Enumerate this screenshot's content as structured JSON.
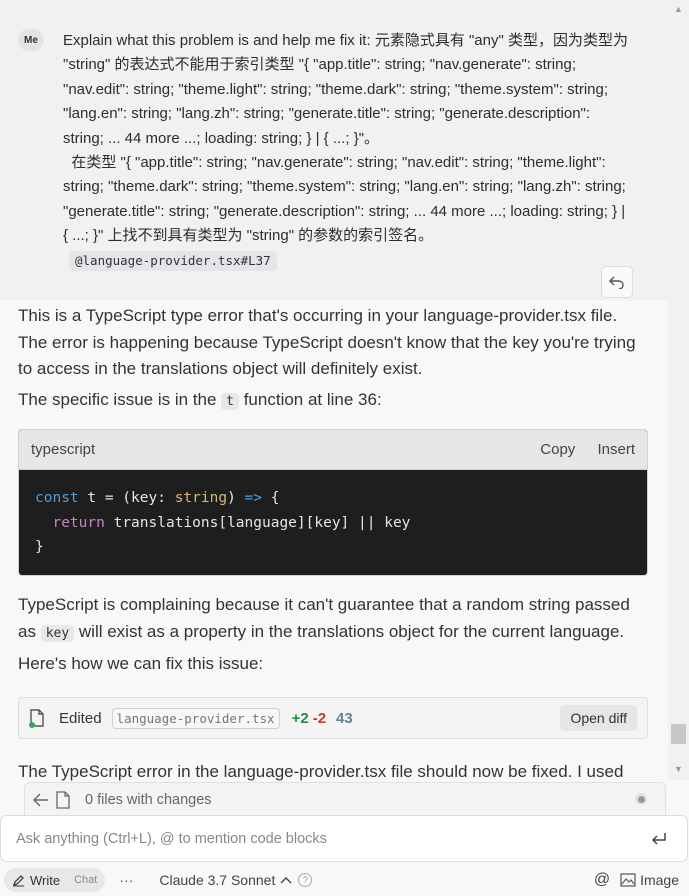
{
  "user_message": {
    "avatar": "Me",
    "text": "Explain what this problem is and help me fix it: 元素隐式具有 \"any\" 类型，因为类型为 \"string\" 的表达式不能用于索引类型 \"{ \"app.title\": string; \"nav.generate\": string; \"nav.edit\": string; \"theme.light\": string; \"theme.dark\": string; \"theme.system\": string; \"lang.en\": string; \"lang.zh\": string; \"generate.title\": string; \"generate.description\": string; ... 44 more ...; loading: string; } | { ...; }\"。\n  在类型 \"{ \"app.title\": string; \"nav.generate\": string; \"nav.edit\": string; \"theme.light\": string; \"theme.dark\": string; \"theme.system\": string; \"lang.en\": string; \"lang.zh\": string; \"generate.title\": string; \"generate.description\": string; ... 44 more ...; loading: string; } | { ...; }\" 上找不到具有类型为 \"string\" 的参数的索引签名。",
    "reference_chip": "@language-provider.tsx#L37"
  },
  "assistant": {
    "para1": "This is a TypeScript type error that's occurring in your language-provider.tsx file. The error is happening because TypeScript doesn't know that the key you're trying to access in the translations object will definitely exist.",
    "para2_before": "The specific issue is in the ",
    "para2_code": "t",
    "para2_after": " function at line 36:",
    "code_block": {
      "language": "typescript",
      "copy_label": "Copy",
      "insert_label": "Insert",
      "lines": [
        "const t = (key: string) => {",
        "  return translations[language][key] || key",
        "}"
      ]
    },
    "para3_before": "TypeScript is complaining because it can't guarantee that a random string passed as ",
    "para3_code": "key",
    "para3_after": " will exist as a property in the translations object for the current language.",
    "para4": "Here's how we can fix this issue:",
    "edit_card": {
      "label": "Edited",
      "file": "language-provider.tsx",
      "added": "+2",
      "removed": "-2",
      "lines": "43",
      "open_diff_label": "Open diff"
    },
    "para5": "The TypeScript error in the language-provider.tsx file should now be fixed. I used"
  },
  "files_bar": {
    "text": "0 files with changes"
  },
  "composer": {
    "placeholder": "Ask anything (Ctrl+L), @ to mention code blocks"
  },
  "bottom_bar": {
    "write_label": "Write",
    "chat_label": "Chat",
    "more_label": "···",
    "model_label": "Claude 3.7 Sonnet",
    "help_label": "?",
    "mention_label": "@",
    "image_label": "Image"
  },
  "colors": {
    "code_bg": "#1e1e1e",
    "added": "#1f8f3a",
    "removed": "#c73a3a"
  }
}
